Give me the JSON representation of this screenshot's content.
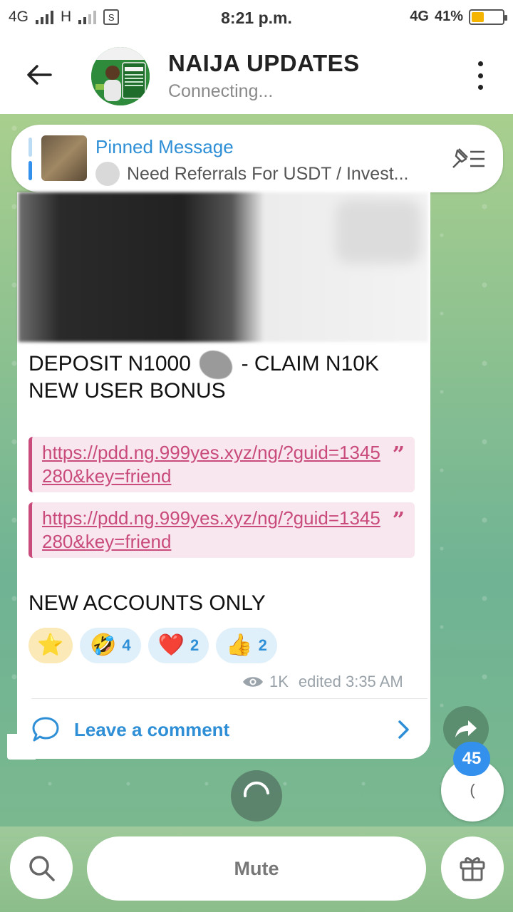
{
  "status_bar": {
    "net1": "4G",
    "net2": "H",
    "time": "8:21 p.m.",
    "net3": "4G",
    "battery": "41%",
    "battery_level": 0.41,
    "sim_icon_text": "S"
  },
  "header": {
    "title": "NAIJA UPDATES",
    "subtitle": "Connecting..."
  },
  "pinned": {
    "label": "Pinned Message",
    "text": "Need Referrals For USDT / Invest..."
  },
  "message": {
    "line1_a": "DEPOSIT N1000",
    "line1_b": "- CLAIM N10K",
    "line2": "NEW USER BONUS",
    "quotes": [
      {
        "url": "https://pdd.ng.999yes.xyz/ng/?guid=1345280&key=friend"
      },
      {
        "url": "https://pdd.ng.999yes.xyz/ng/?guid=1345280&key=friend"
      }
    ],
    "line3": "NEW ACCOUNTS ONLY",
    "reactions": [
      {
        "emoji": "⭐",
        "count": ""
      },
      {
        "emoji": "🤣",
        "count": "4"
      },
      {
        "emoji": "❤️",
        "count": "2"
      },
      {
        "emoji": "👍",
        "count": "2"
      }
    ],
    "views": "1K",
    "edited": "edited 3:35 AM",
    "comment_label": "Leave a comment"
  },
  "floating": {
    "unread_badge": "45",
    "scroll_glyph": "("
  },
  "bottom_bar": {
    "mute_label": "Mute"
  },
  "colors": {
    "accent": "#3390ec",
    "link": "#c94b7c",
    "pinned_title": "#2f8fd6",
    "battery": "#f4b400"
  },
  "icons": [
    "back-arrow-icon",
    "more-vert-icon",
    "unpin-list-icon",
    "eye-icon",
    "comment-bubble-icon",
    "chevron-right-icon",
    "share-icon",
    "search-icon",
    "gift-icon",
    "loading-spinner-icon"
  ]
}
